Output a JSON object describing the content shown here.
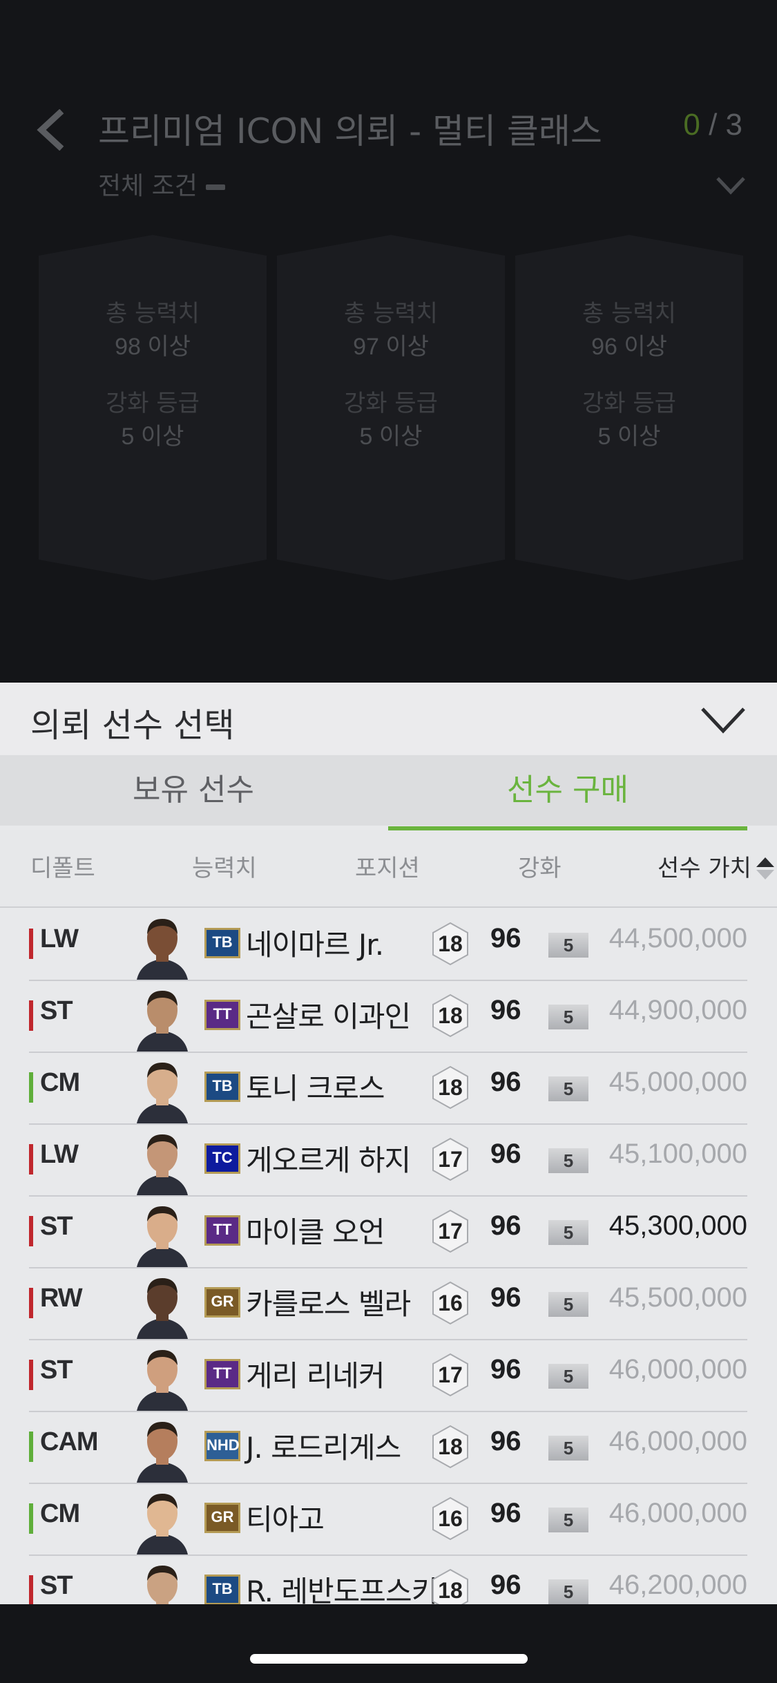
{
  "header": {
    "title": "프리미엄 ICON 의뢰 - 멀티 클래스",
    "counter_current": "0",
    "counter_total": "/ 3",
    "subtitle": "전체 조건"
  },
  "requirement_cards": [
    {
      "label1": "총 능력치",
      "value1": "98 이상",
      "label2": "강화 등급",
      "value2": "5 이상"
    },
    {
      "label1": "총 능력치",
      "value1": "97 이상",
      "label2": "강화 등급",
      "value2": "5 이상"
    },
    {
      "label1": "총 능력치",
      "value1": "96 이상",
      "label2": "강화 등급",
      "value2": "5 이상"
    }
  ],
  "sheet": {
    "title": "의뢰 선수 선택",
    "tabs": {
      "owned": "보유 선수",
      "buy": "선수 구매"
    },
    "active_tab": "buy",
    "columns": {
      "default": "디폴트",
      "ability": "능력치",
      "position": "포지션",
      "enhance": "강화",
      "value": "선수 가치"
    }
  },
  "players": [
    {
      "pos": "LW",
      "pos_color": "#c0272d",
      "season": "TB",
      "season_color": "#1c4a83",
      "name": "네이마르 Jr.",
      "ovr": "18",
      "stat": "96",
      "grade": "5",
      "price": "44,500,000",
      "affordable": false
    },
    {
      "pos": "ST",
      "pos_color": "#c0272d",
      "season": "TT",
      "season_color": "#5a2a86",
      "name": "곤살로 이과인",
      "ovr": "18",
      "stat": "96",
      "grade": "5",
      "price": "44,900,000",
      "affordable": false
    },
    {
      "pos": "CM",
      "pos_color": "#5fae3a",
      "season": "TB",
      "season_color": "#1c4a83",
      "name": "토니 크로스",
      "ovr": "18",
      "stat": "96",
      "grade": "5",
      "price": "45,000,000",
      "affordable": false
    },
    {
      "pos": "LW",
      "pos_color": "#c0272d",
      "season": "TC",
      "season_color": "#0d1b9e",
      "name": "게오르게 하지",
      "ovr": "17",
      "stat": "96",
      "grade": "5",
      "price": "45,100,000",
      "affordable": false
    },
    {
      "pos": "ST",
      "pos_color": "#c0272d",
      "season": "TT",
      "season_color": "#5a2a86",
      "name": "마이클 오언",
      "ovr": "17",
      "stat": "96",
      "grade": "5",
      "price": "45,300,000",
      "affordable": true
    },
    {
      "pos": "RW",
      "pos_color": "#c0272d",
      "season": "GR",
      "season_color": "#7a5a26",
      "name": "카를로스 벨라",
      "ovr": "16",
      "stat": "96",
      "grade": "5",
      "price": "45,500,000",
      "affordable": false
    },
    {
      "pos": "ST",
      "pos_color": "#c0272d",
      "season": "TT",
      "season_color": "#5a2a86",
      "name": "게리 리네커",
      "ovr": "17",
      "stat": "96",
      "grade": "5",
      "price": "46,000,000",
      "affordable": false
    },
    {
      "pos": "CAM",
      "pos_color": "#5fae3a",
      "season": "NHD",
      "season_color": "#2d5f96",
      "name": "J. 로드리게스",
      "ovr": "18",
      "stat": "96",
      "grade": "5",
      "price": "46,000,000",
      "affordable": false
    },
    {
      "pos": "CM",
      "pos_color": "#5fae3a",
      "season": "GR",
      "season_color": "#7a5a26",
      "name": "티아고",
      "ovr": "16",
      "stat": "96",
      "grade": "5",
      "price": "46,000,000",
      "affordable": false
    },
    {
      "pos": "ST",
      "pos_color": "#c0272d",
      "season": "TB",
      "season_color": "#1c4a83",
      "name": "R. 레반도프스키",
      "ovr": "18",
      "stat": "96",
      "grade": "5",
      "price": "46,200,000",
      "affordable": false
    }
  ]
}
